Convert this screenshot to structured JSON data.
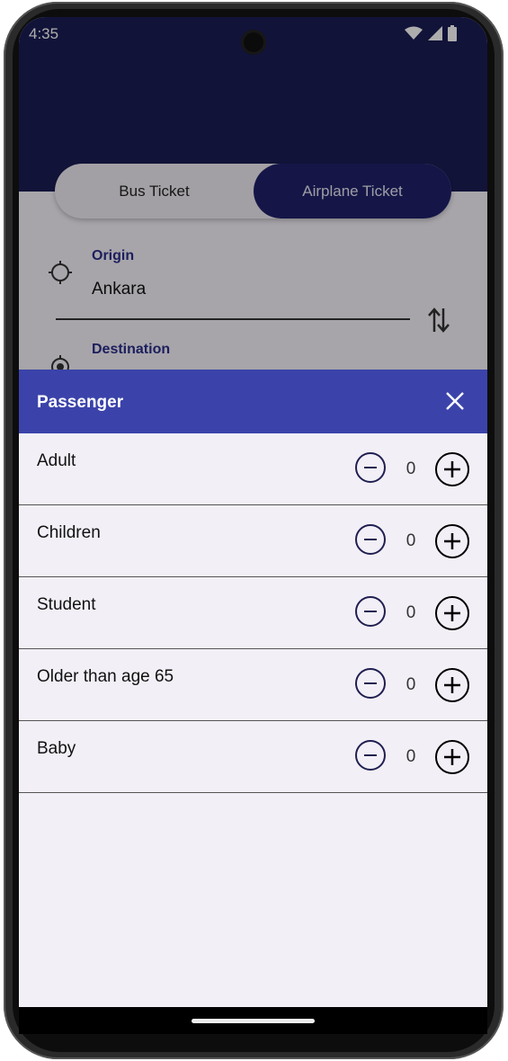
{
  "status_bar": {
    "time": "4:35"
  },
  "tabs": {
    "bus": "Bus Ticket",
    "airplane": "Airplane Ticket"
  },
  "route": {
    "origin_label": "Origin",
    "origin_value": "Ankara",
    "destination_label": "Destination"
  },
  "sheet": {
    "title": "Passenger",
    "rows": [
      {
        "label": "Adult",
        "count": "0"
      },
      {
        "label": "Children",
        "count": "0"
      },
      {
        "label": "Student",
        "count": "0"
      },
      {
        "label": "Older than age 65",
        "count": "0"
      },
      {
        "label": "Baby",
        "count": "0"
      }
    ]
  },
  "colors": {
    "header": "#1b1d55",
    "sheet_header": "#3b43aa",
    "accent": "#2c2e8a"
  },
  "icons": [
    "wifi-icon",
    "signal-icon",
    "battery-icon",
    "location-target-icon",
    "swap-icon",
    "close-icon",
    "minus-circle-icon",
    "plus-circle-icon"
  ]
}
